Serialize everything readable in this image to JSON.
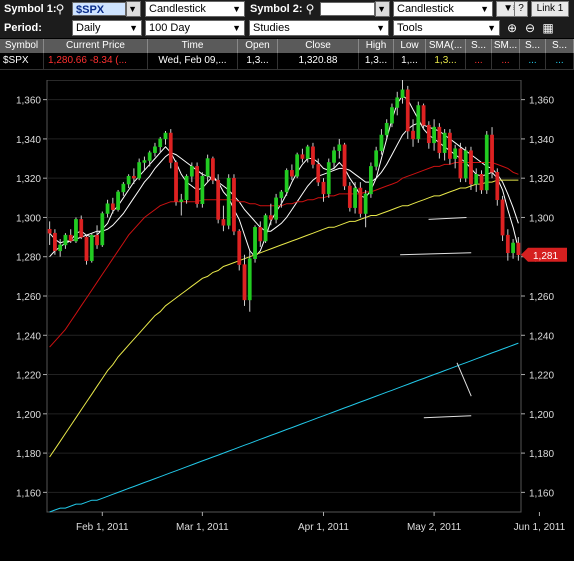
{
  "toolbar": {
    "symbol1_label": "Symbol 1:",
    "symbol1_value": "$SPX",
    "chart_type_1": "Candlestick",
    "symbol2_label": "Symbol 2:",
    "symbol2_value": "",
    "chart_type_2": "Candlestick",
    "link_label": "Link 1",
    "help_label": "?",
    "period_label": "Period:",
    "period_value": "Daily",
    "range_value": "100 Day",
    "studies_label": "Studies",
    "tools_label": "Tools",
    "icons": [
      "search-icon",
      "menu-icon",
      "zoom-in-icon",
      "zoom-out-icon"
    ]
  },
  "quote_table": {
    "headers": [
      "Symbol",
      "Current Price",
      "Time",
      "Open",
      "Close",
      "High",
      "Low",
      "SMA(...",
      "S...",
      "SM...",
      "S...",
      "S..."
    ],
    "row": {
      "symbol": "$SPX",
      "price": "1,280.66",
      "change": "-8.34",
      "change_more": "(...",
      "time": "Wed, Feb 09,...",
      "open": "1,3...",
      "close": "1,320.88",
      "high": "1,3...",
      "low": "1,...",
      "sma": "1,3...",
      "c9": "...",
      "c10": "...",
      "c11": "...",
      "c12": "..."
    }
  },
  "colors": {
    "up": "#22cc22",
    "down": "#dd2222",
    "sma5": "#ffffff",
    "sma10": "#ffffff",
    "sma20": "#cc1111",
    "sma50": "#e8e84a",
    "sma200": "#22c8e8",
    "price_tag": "#d62020",
    "sma_value": "#e8e84a",
    "neg": "#ff3030"
  },
  "chart_data": {
    "type": "candlestick",
    "ylim": [
      1150,
      1370
    ],
    "yticks": [
      "1,160",
      "1,180",
      "1,200",
      "1,220",
      "1,240",
      "1,260",
      "1,280",
      "1,300",
      "1,320",
      "1,340",
      "1,360"
    ],
    "yticks_values": [
      1160,
      1180,
      1200,
      1220,
      1240,
      1260,
      1280,
      1300,
      1320,
      1340,
      1360
    ],
    "xticks": [
      "Feb 1, 2011",
      "Mar 1, 2011",
      "Apr 1, 2011",
      "May 2, 2011",
      "Jun 1, 2011"
    ],
    "xticks_index": [
      10,
      29,
      52,
      73,
      93
    ],
    "last_price_tag": "1,281",
    "last_price_value": 1281,
    "candles": [
      [
        1294,
        1298,
        1286,
        1292
      ],
      [
        1292,
        1294,
        1281,
        1283
      ],
      [
        1283,
        1289,
        1280,
        1286
      ],
      [
        1286,
        1292,
        1284,
        1291
      ],
      [
        1291,
        1294,
        1287,
        1288
      ],
      [
        1288,
        1300,
        1287,
        1299
      ],
      [
        1299,
        1301,
        1289,
        1290
      ],
      [
        1290,
        1291,
        1276,
        1278
      ],
      [
        1278,
        1292,
        1277,
        1291
      ],
      [
        1291,
        1296,
        1284,
        1286
      ],
      [
        1286,
        1303,
        1285,
        1302
      ],
      [
        1302,
        1309,
        1300,
        1307
      ],
      [
        1307,
        1310,
        1302,
        1304
      ],
      [
        1304,
        1314,
        1303,
        1313
      ],
      [
        1313,
        1318,
        1311,
        1317
      ],
      [
        1317,
        1322,
        1315,
        1321
      ],
      [
        1321,
        1325,
        1317,
        1320
      ],
      [
        1320,
        1330,
        1319,
        1328
      ],
      [
        1328,
        1331,
        1324,
        1329
      ],
      [
        1329,
        1334,
        1326,
        1333
      ],
      [
        1333,
        1338,
        1331,
        1336
      ],
      [
        1336,
        1341,
        1333,
        1340
      ],
      [
        1340,
        1344,
        1337,
        1343
      ],
      [
        1343,
        1345,
        1325,
        1328
      ],
      [
        1328,
        1329,
        1306,
        1308
      ],
      [
        1308,
        1312,
        1301,
        1309
      ],
      [
        1309,
        1322,
        1307,
        1321
      ],
      [
        1321,
        1328,
        1318,
        1326
      ],
      [
        1326,
        1328,
        1305,
        1307
      ],
      [
        1307,
        1323,
        1305,
        1321
      ],
      [
        1321,
        1332,
        1318,
        1330
      ],
      [
        1330,
        1331,
        1317,
        1319
      ],
      [
        1319,
        1322,
        1297,
        1299
      ],
      [
        1299,
        1306,
        1293,
        1296
      ],
      [
        1296,
        1322,
        1294,
        1320
      ],
      [
        1320,
        1322,
        1291,
        1293
      ],
      [
        1293,
        1294,
        1273,
        1276
      ],
      [
        1276,
        1281,
        1255,
        1258
      ],
      [
        1258,
        1283,
        1252,
        1279
      ],
      [
        1279,
        1296,
        1277,
        1295
      ],
      [
        1295,
        1298,
        1285,
        1288
      ],
      [
        1288,
        1302,
        1287,
        1301
      ],
      [
        1301,
        1307,
        1296,
        1299
      ],
      [
        1299,
        1312,
        1297,
        1310
      ],
      [
        1310,
        1314,
        1305,
        1313
      ],
      [
        1313,
        1325,
        1311,
        1324
      ],
      [
        1324,
        1327,
        1319,
        1321
      ],
      [
        1321,
        1333,
        1320,
        1332
      ],
      [
        1332,
        1335,
        1328,
        1330
      ],
      [
        1330,
        1337,
        1328,
        1336
      ],
      [
        1336,
        1338,
        1325,
        1327
      ],
      [
        1327,
        1330,
        1316,
        1318
      ],
      [
        1318,
        1320,
        1308,
        1312
      ],
      [
        1312,
        1330,
        1310,
        1328
      ],
      [
        1328,
        1336,
        1325,
        1334
      ],
      [
        1334,
        1340,
        1330,
        1337
      ],
      [
        1337,
        1338,
        1314,
        1316
      ],
      [
        1316,
        1318,
        1303,
        1305
      ],
      [
        1305,
        1318,
        1302,
        1315
      ],
      [
        1315,
        1318,
        1300,
        1302
      ],
      [
        1302,
        1314,
        1295,
        1312
      ],
      [
        1312,
        1328,
        1310,
        1326
      ],
      [
        1326,
        1336,
        1324,
        1334
      ],
      [
        1334,
        1345,
        1332,
        1342
      ],
      [
        1342,
        1350,
        1340,
        1348
      ],
      [
        1348,
        1358,
        1346,
        1356
      ],
      [
        1356,
        1364,
        1352,
        1361
      ],
      [
        1361,
        1370,
        1358,
        1365
      ],
      [
        1365,
        1367,
        1340,
        1344
      ],
      [
        1344,
        1350,
        1336,
        1340
      ],
      [
        1340,
        1359,
        1338,
        1357
      ],
      [
        1357,
        1358,
        1345,
        1347
      ],
      [
        1347,
        1349,
        1335,
        1338
      ],
      [
        1338,
        1350,
        1334,
        1346
      ],
      [
        1346,
        1348,
        1330,
        1333
      ],
      [
        1333,
        1345,
        1329,
        1343
      ],
      [
        1343,
        1345,
        1327,
        1330
      ],
      [
        1330,
        1337,
        1325,
        1335
      ],
      [
        1335,
        1338,
        1318,
        1320
      ],
      [
        1320,
        1336,
        1318,
        1334
      ],
      [
        1334,
        1336,
        1314,
        1317
      ],
      [
        1317,
        1325,
        1313,
        1322
      ],
      [
        1322,
        1324,
        1312,
        1314
      ],
      [
        1314,
        1344,
        1312,
        1342
      ],
      [
        1342,
        1346,
        1320,
        1323
      ],
      [
        1323,
        1325,
        1306,
        1309
      ],
      [
        1309,
        1311,
        1288,
        1291
      ],
      [
        1291,
        1294,
        1278,
        1282
      ],
      [
        1282,
        1289,
        1279,
        1287
      ],
      [
        1287,
        1290,
        1278,
        1281
      ]
    ],
    "sma_lines": [
      {
        "name": "sma5",
        "color": "sma5",
        "start_index": 0,
        "values": [
          1292,
          1289,
          1287,
          1288,
          1288,
          1292,
          1293,
          1291,
          1290,
          1291,
          1294,
          1297,
          1303,
          1306,
          1310,
          1314,
          1318,
          1321,
          1324,
          1327,
          1330,
          1333,
          1336,
          1333,
          1328,
          1322,
          1318,
          1316,
          1314,
          1315,
          1318,
          1321,
          1318,
          1313,
          1310,
          1304,
          1299,
          1291,
          1283,
          1280,
          1283,
          1290,
          1298,
          1303,
          1307,
          1312,
          1318,
          1323,
          1327,
          1330,
          1330,
          1328,
          1325,
          1324,
          1325,
          1328,
          1325,
          1320,
          1316,
          1311,
          1310,
          1314,
          1320,
          1330,
          1340,
          1350,
          1358,
          1362,
          1360,
          1355,
          1350,
          1345,
          1342,
          1340,
          1338,
          1336,
          1334,
          1332,
          1330,
          1328,
          1325,
          1322,
          1321,
          1322,
          1323,
          1320,
          1314,
          1304,
          1295,
          1284
        ]
      },
      {
        "name": "sma10",
        "color": "sma10",
        "start_index": 0,
        "values": [
          1280,
          1283,
          1285,
          1287,
          1288,
          1289,
          1290,
          1291,
          1292,
          1293,
          1293,
          1294,
          1296,
          1299,
          1302,
          1306,
          1310,
          1314,
          1318,
          1321,
          1325,
          1328,
          1331,
          1333,
          1332,
          1330,
          1328,
          1326,
          1324,
          1322,
          1321,
          1320,
          1318,
          1316,
          1314,
          1311,
          1308,
          1304,
          1301,
          1298,
          1295,
          1293,
          1293,
          1295,
          1297,
          1300,
          1304,
          1308,
          1312,
          1316,
          1319,
          1321,
          1322,
          1323,
          1324,
          1325,
          1325,
          1324,
          1322,
          1320,
          1318,
          1318,
          1320,
          1323,
          1327,
          1332,
          1337,
          1342,
          1345,
          1347,
          1348,
          1347,
          1346,
          1345,
          1344,
          1342,
          1340,
          1338,
          1336,
          1334,
          1332,
          1330,
          1328,
          1326,
          1325,
          1322,
          1318,
          1312,
          1305,
          1297
        ]
      },
      {
        "name": "sma20",
        "color": "sma20",
        "start_index": 0,
        "values": [
          1234,
          1237,
          1240,
          1243,
          1247,
          1251,
          1255,
          1259,
          1263,
          1267,
          1271,
          1275,
          1279,
          1283,
          1287,
          1291,
          1294,
          1297,
          1300,
          1302,
          1304,
          1306,
          1307,
          1308,
          1308,
          1308,
          1308,
          1308,
          1308,
          1309,
          1309,
          1309,
          1309,
          1309,
          1309,
          1309,
          1308,
          1308,
          1307,
          1307,
          1306,
          1306,
          1306,
          1306,
          1306,
          1307,
          1307,
          1308,
          1308,
          1309,
          1309,
          1310,
          1310,
          1311,
          1311,
          1312,
          1312,
          1312,
          1312,
          1312,
          1313,
          1313,
          1314,
          1315,
          1316,
          1317,
          1318,
          1320,
          1321,
          1322,
          1323,
          1324,
          1325,
          1326,
          1326,
          1327,
          1327,
          1328,
          1328,
          1328,
          1328,
          1328,
          1328,
          1328,
          1328,
          1327,
          1326,
          1325,
          1323,
          1322
        ]
      },
      {
        "name": "sma50",
        "color": "sma50",
        "start_index": 0,
        "values": [
          1178,
          1182,
          1186,
          1190,
          1194,
          1198,
          1202,
          1206,
          1210,
          1214,
          1218,
          1222,
          1225,
          1229,
          1232,
          1235,
          1238,
          1241,
          1244,
          1247,
          1250,
          1252,
          1255,
          1257,
          1259,
          1261,
          1263,
          1265,
          1267,
          1269,
          1270,
          1272,
          1273,
          1275,
          1276,
          1277,
          1278,
          1279,
          1280,
          1281,
          1282,
          1283,
          1284,
          1285,
          1286,
          1287,
          1288,
          1289,
          1290,
          1291,
          1292,
          1293,
          1294,
          1295,
          1295,
          1296,
          1297,
          1298,
          1298,
          1299,
          1300,
          1301,
          1301,
          1302,
          1303,
          1304,
          1305,
          1306,
          1306,
          1307,
          1308,
          1309,
          1310,
          1311,
          1311,
          1312,
          1313,
          1314,
          1315,
          1315,
          1316,
          1317,
          1317,
          1318,
          1318,
          1319,
          1319,
          1319,
          1319,
          1319
        ]
      },
      {
        "name": "sma200",
        "color": "sma200",
        "start_index": 0,
        "values": [
          1150,
          1151,
          1152,
          1152,
          1153,
          1154,
          1154,
          1155,
          1156,
          1156,
          1157,
          1158,
          1159,
          1160,
          1161,
          1162,
          1163,
          1164,
          1165,
          1166,
          1167,
          1168,
          1169,
          1170,
          1171,
          1172,
          1173,
          1174,
          1175,
          1176,
          1177,
          1178,
          1179,
          1180,
          1181,
          1182,
          1183,
          1184,
          1185,
          1186,
          1187,
          1188,
          1189,
          1190,
          1191,
          1192,
          1193,
          1194,
          1195,
          1196,
          1197,
          1198,
          1199,
          1200,
          1201,
          1202,
          1203,
          1204,
          1205,
          1206,
          1207,
          1208,
          1209,
          1210,
          1211,
          1212,
          1213,
          1214,
          1215,
          1216,
          1217,
          1218,
          1219,
          1220,
          1221,
          1222,
          1223,
          1224,
          1225,
          1226,
          1227,
          1228,
          1229,
          1230,
          1231,
          1232,
          1233,
          1234,
          1235,
          1236
        ]
      }
    ],
    "annotation_lines": [
      {
        "x1": 80.5,
        "y1": 1299,
        "x2": 88.5,
        "y2": 1300
      },
      {
        "x1": 74.5,
        "y1": 1281,
        "x2": 89.5,
        "y2": 1282
      },
      {
        "x1": 86.5,
        "y1": 1226,
        "x2": 89.5,
        "y2": 1209
      },
      {
        "x1": 79.5,
        "y1": 1198,
        "x2": 89.5,
        "y2": 1199
      }
    ]
  }
}
